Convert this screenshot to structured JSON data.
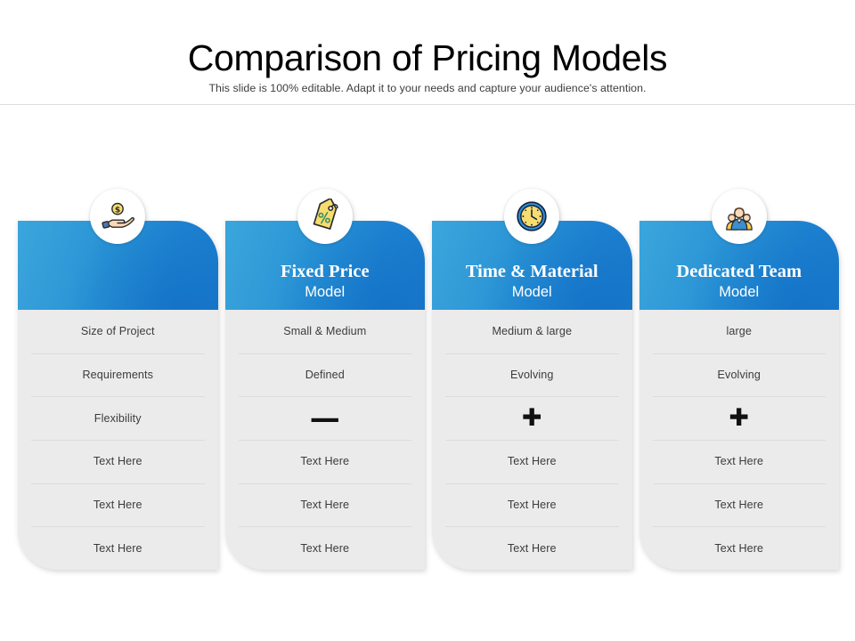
{
  "header": {
    "title": "Comparison of Pricing Models",
    "subtitle": "This slide is 100% editable. Adapt it to your needs and capture your audience's attention."
  },
  "colors": {
    "header_blue_light": "#2fa0da",
    "header_blue_dark": "#1b7ccd",
    "body_grey": "#ebebeb",
    "divider": "#dcdcdc",
    "text": "#3c3c3c",
    "icon_yellow": "#f7dd6e",
    "icon_blue": "#1b7ccd"
  },
  "cards": [
    {
      "icon": "hand-coin-icon",
      "title": "",
      "subtitle": "",
      "rows": [
        {
          "text": "Size of Project",
          "type": "text"
        },
        {
          "text": "Requirements",
          "type": "text"
        },
        {
          "text": "Flexibility",
          "type": "text"
        },
        {
          "text": "Text Here",
          "type": "text"
        },
        {
          "text": "Text Here",
          "type": "text"
        },
        {
          "text": "Text Here",
          "type": "text"
        }
      ]
    },
    {
      "icon": "price-tag-icon",
      "title": "Fixed Price",
      "subtitle": "Model",
      "rows": [
        {
          "text": "Small & Medium",
          "type": "text"
        },
        {
          "text": "Defined",
          "type": "text"
        },
        {
          "text": "—",
          "type": "minus"
        },
        {
          "text": "Text Here",
          "type": "text"
        },
        {
          "text": "Text Here",
          "type": "text"
        },
        {
          "text": "Text Here",
          "type": "text"
        }
      ]
    },
    {
      "icon": "clock-icon",
      "title": "Time & Material",
      "subtitle": "Model",
      "rows": [
        {
          "text": "Medium & large",
          "type": "text"
        },
        {
          "text": "Evolving",
          "type": "text"
        },
        {
          "text": "✚",
          "type": "plus"
        },
        {
          "text": "Text Here",
          "type": "text"
        },
        {
          "text": "Text Here",
          "type": "text"
        },
        {
          "text": "Text Here",
          "type": "text"
        }
      ]
    },
    {
      "icon": "team-icon",
      "title": "Dedicated Team",
      "subtitle": "Model",
      "rows": [
        {
          "text": "large",
          "type": "text"
        },
        {
          "text": "Evolving",
          "type": "text"
        },
        {
          "text": "✚",
          "type": "plus"
        },
        {
          "text": "Text Here",
          "type": "text"
        },
        {
          "text": "Text Here",
          "type": "text"
        },
        {
          "text": "Text Here",
          "type": "text"
        }
      ]
    }
  ]
}
